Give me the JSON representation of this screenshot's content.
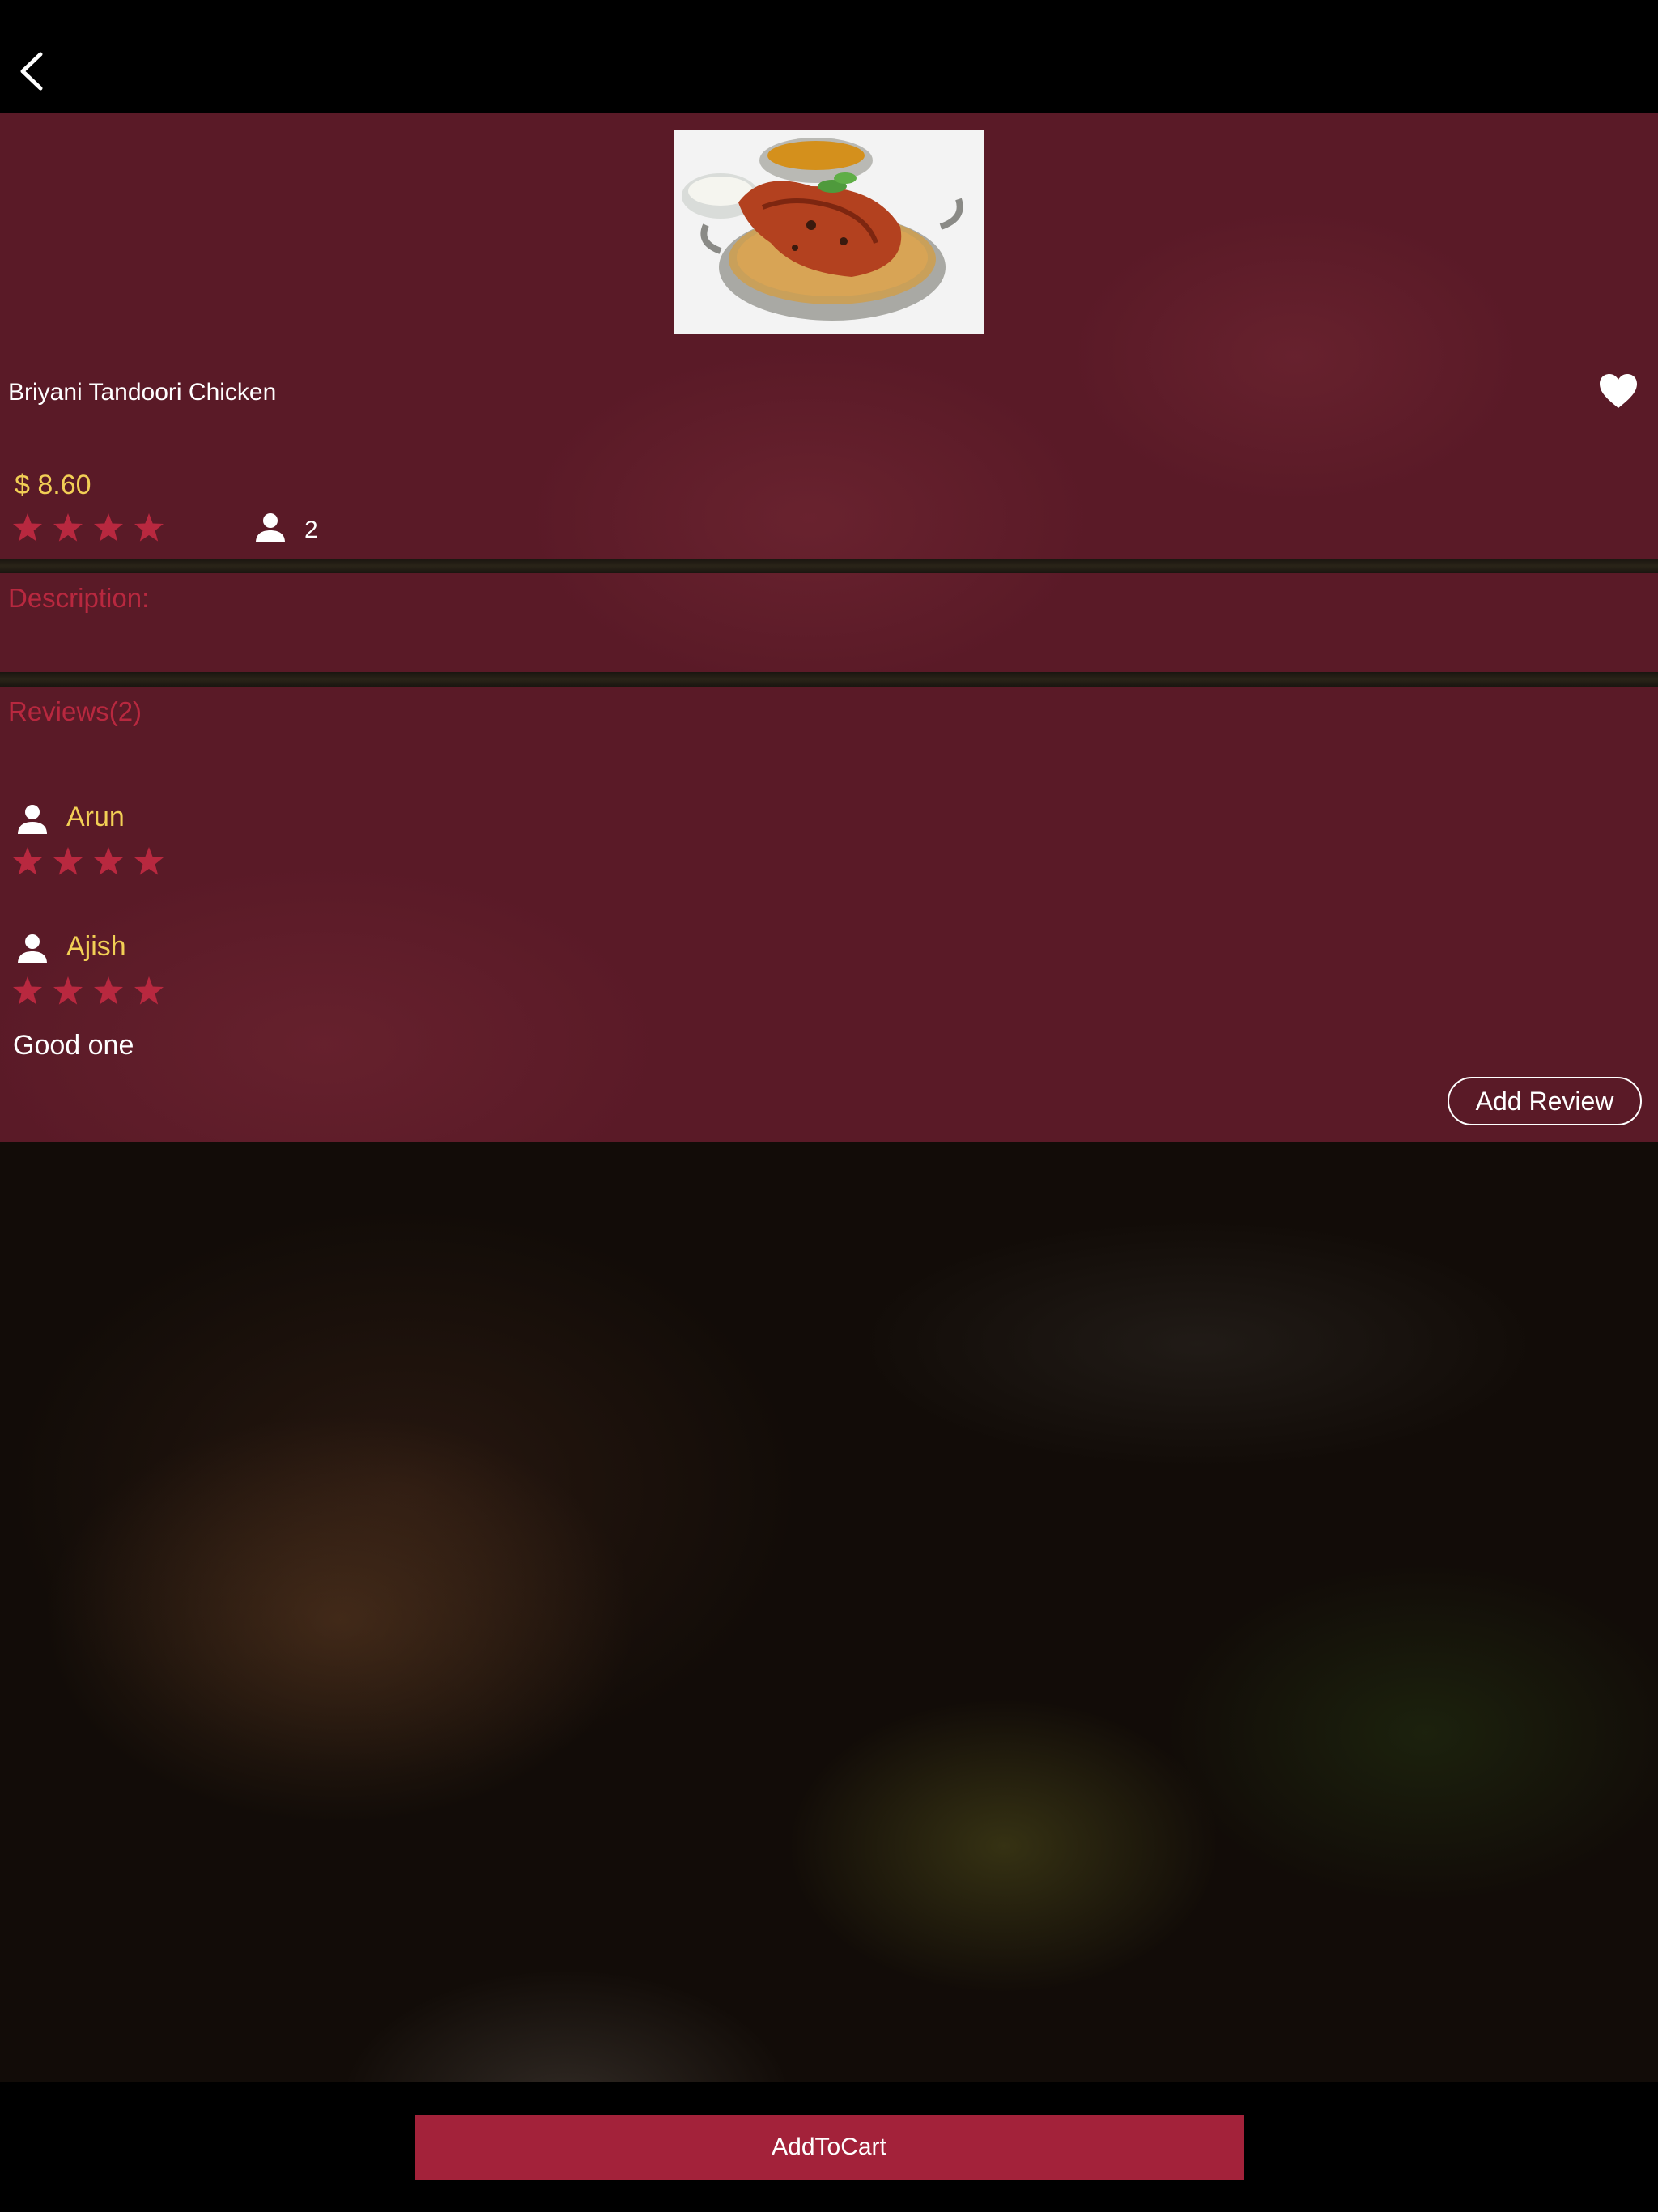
{
  "nav": {
    "back_icon": "chevron-left-icon"
  },
  "dish": {
    "name": "Briyani Tandoori Chicken",
    "price": "$ 8.60",
    "rating": 4,
    "serves": "2",
    "favorite_icon": "heart-icon"
  },
  "sections": {
    "description_label": "Description:",
    "reviews_label": "Reviews(2)"
  },
  "reviews": [
    {
      "name": "Arun",
      "rating": 4,
      "text": ""
    },
    {
      "name": "Ajish",
      "rating": 4,
      "text": "Good one"
    }
  ],
  "buttons": {
    "add_review": "Add Review",
    "add_to_cart": "AddToCart"
  },
  "colors": {
    "panel": "#5a1a27",
    "star": "#b8283f",
    "accent_yellow": "#f2cf55",
    "cart_button": "#a3223a"
  }
}
